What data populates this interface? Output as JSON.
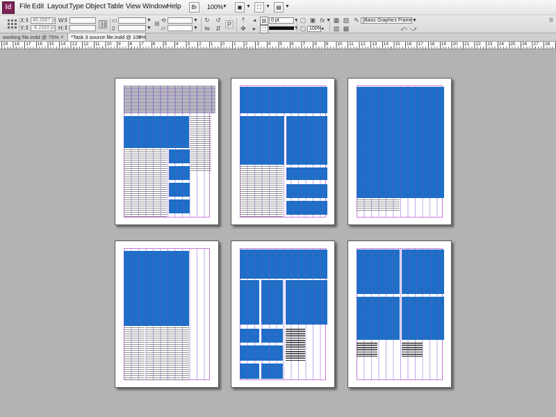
{
  "menubar": {
    "app_icon": "Id",
    "items": [
      "File",
      "Edit",
      "Layout",
      "Type",
      "Object",
      "Table",
      "View",
      "Window",
      "Help"
    ],
    "bridge_label": "Br",
    "zoom": "100%"
  },
  "control_panel": {
    "x_label": "X:",
    "x_value": "46.2667 pm",
    "y_label": "Y:",
    "y_value": "-6.2333 pm",
    "w_label": "W:",
    "h_label": "H:",
    "stroke_weight": "0 pt",
    "opacity": "100%",
    "object_style": "[Basic Graphics Frame]+"
  },
  "tabs": [
    {
      "label": "working file.indd @ 75%",
      "close": "×",
      "active": false
    },
    {
      "label": "*Task 3 source file.indd @ 100%",
      "close": "×",
      "active": true
    }
  ],
  "ruler": {
    "numbers": [
      "19",
      "18",
      "17",
      "16",
      "15",
      "14",
      "13",
      "12",
      "11",
      "10",
      "9",
      "8",
      "7",
      "6",
      "5",
      "4",
      "3",
      "2",
      "1",
      "0",
      "1",
      "2",
      "3",
      "4",
      "5",
      "6",
      "7",
      "8",
      "9",
      "10",
      "11",
      "12",
      "13",
      "14",
      "15",
      "16",
      "17",
      "18",
      "19",
      "20",
      "21",
      "22",
      "23",
      "24",
      "25",
      "26",
      "27",
      "28"
    ]
  },
  "colors": {
    "frame_blue": "#1d6fc7",
    "pasteboard": "#b3b3b3",
    "grid_guide": "#b89ae8"
  }
}
